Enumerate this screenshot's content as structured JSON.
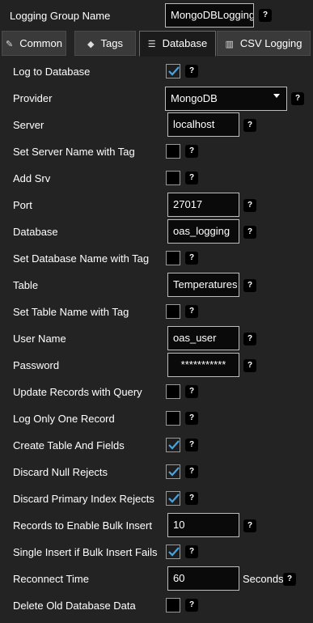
{
  "header": {
    "group_label": "Logging Group Name",
    "group_value": "MongoDBLogging",
    "help": "?"
  },
  "tabs": [
    {
      "label": "Common",
      "icon": "pin-icon",
      "active": false
    },
    {
      "label": "Tags",
      "icon": "tag-icon",
      "active": false
    },
    {
      "label": "Database",
      "icon": "database-icon",
      "active": true
    },
    {
      "label": "CSV Logging",
      "icon": "csv-icon",
      "active": false
    }
  ],
  "form": {
    "log_to_database": {
      "label": "Log to Database",
      "checked": true
    },
    "provider": {
      "label": "Provider",
      "value": "MongoDB"
    },
    "server": {
      "label": "Server",
      "value": "localhost"
    },
    "set_server_name_with_tag": {
      "label": "Set Server Name with Tag",
      "checked": false
    },
    "add_srv": {
      "label": "Add Srv",
      "checked": false
    },
    "port": {
      "label": "Port",
      "value": "27017"
    },
    "database": {
      "label": "Database",
      "value": "oas_logging"
    },
    "set_database_name_with_tag": {
      "label": "Set Database Name with Tag",
      "checked": false
    },
    "table": {
      "label": "Table",
      "value": "Temperatures"
    },
    "set_table_name_with_tag": {
      "label": "Set Table Name with Tag",
      "checked": false
    },
    "user_name": {
      "label": "User Name",
      "value": "oas_user"
    },
    "password": {
      "label": "Password",
      "value": "***********"
    },
    "update_records_with_query": {
      "label": "Update Records with Query",
      "checked": false
    },
    "log_only_one_record": {
      "label": "Log Only One Record",
      "checked": false
    },
    "create_table_and_fields": {
      "label": "Create Table And Fields",
      "checked": true
    },
    "discard_null_rejects": {
      "label": "Discard Null Rejects",
      "checked": true
    },
    "discard_primary_index_rejects": {
      "label": "Discard Primary Index Rejects",
      "checked": true
    },
    "records_to_enable_bulk_insert": {
      "label": "Records to Enable Bulk Insert",
      "value": "10"
    },
    "single_insert_if_bulk_insert_fails": {
      "label": "Single Insert if Bulk Insert Fails",
      "checked": true
    },
    "reconnect_time": {
      "label": "Reconnect Time",
      "value": "60",
      "unit": "Seconds"
    },
    "delete_old_database_data": {
      "label": "Delete Old Database Data",
      "checked": false
    }
  },
  "colors": {
    "background": "#232323",
    "check": "#4aa3df"
  }
}
